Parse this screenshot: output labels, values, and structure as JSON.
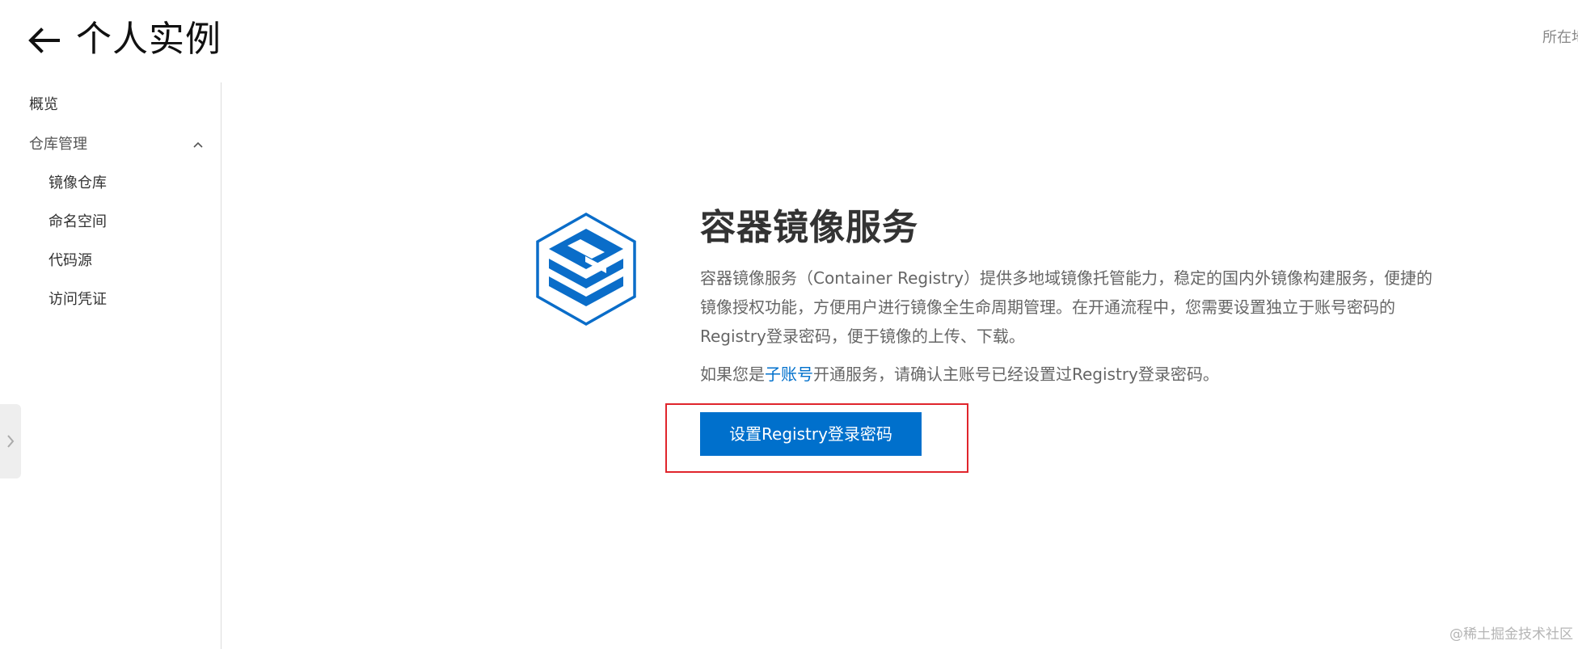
{
  "header": {
    "title": "个人实例",
    "back_icon": "arrow-left-icon",
    "region_label": "所在地域"
  },
  "sidebar": {
    "overview": "概览",
    "repo_group": {
      "label": "仓库管理",
      "expanded": true,
      "items": [
        {
          "label": "镜像仓库"
        },
        {
          "label": "命名空间"
        },
        {
          "label": "代码源"
        },
        {
          "label": "访问凭证"
        }
      ]
    }
  },
  "main": {
    "service_title": "容器镜像服务",
    "description": "容器镜像服务（Container Registry）提供多地域镜像托管能力，稳定的国内外镜像构建服务，便捷的镜像授权功能，方便用户进行镜像全生命周期管理。在开通流程中，您需要设置独立于账号密码的Registry登录密码，便于镜像的上传、下载。",
    "note_prefix": "如果您是",
    "note_link": "子账号",
    "note_suffix": "开通服务，请确认主账号已经设置过Registry登录密码。",
    "button_label": "设置Registry登录密码"
  },
  "watermark": "@稀土掘金技术社区",
  "colors": {
    "accent": "#0070cc",
    "highlight": "#e0252c"
  }
}
